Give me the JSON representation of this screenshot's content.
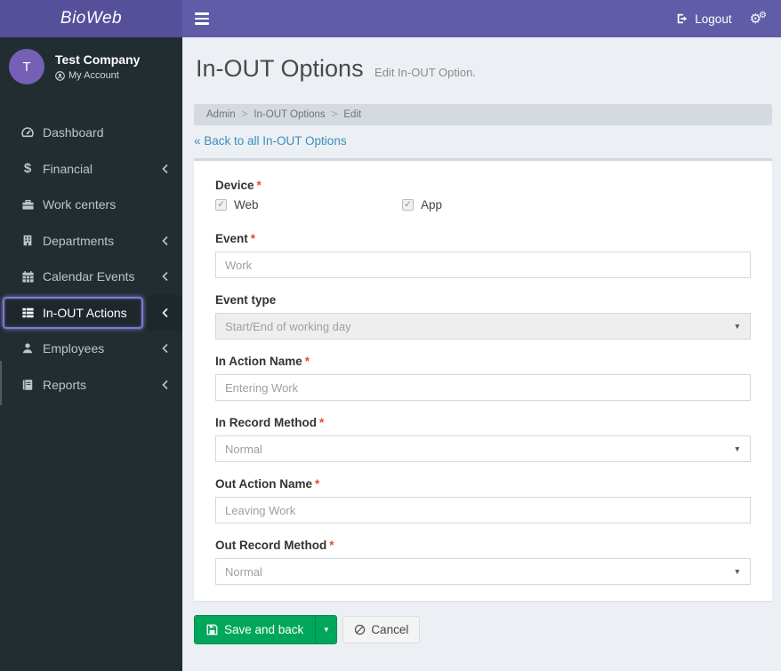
{
  "header": {
    "brand": "BioWeb",
    "logout_label": "Logout"
  },
  "sidebar": {
    "avatar_initial": "T",
    "company_name": "Test Company",
    "account_label": "My Account",
    "items": [
      {
        "label": "Dashboard",
        "has_chevron": false,
        "active": false
      },
      {
        "label": "Financial",
        "has_chevron": true,
        "active": false
      },
      {
        "label": "Work centers",
        "has_chevron": false,
        "active": false
      },
      {
        "label": "Departments",
        "has_chevron": true,
        "active": false
      },
      {
        "label": "Calendar Events",
        "has_chevron": true,
        "active": false
      },
      {
        "label": "In-OUT Actions",
        "has_chevron": true,
        "active": true
      },
      {
        "label": "Employees",
        "has_chevron": true,
        "active": false
      },
      {
        "label": "Reports",
        "has_chevron": true,
        "active": false
      }
    ]
  },
  "page": {
    "title": "In-OUT Options",
    "subtitle": "Edit In-OUT Option.",
    "breadcrumb": {
      "0": "Admin",
      "1": "In-OUT Options",
      "2": "Edit"
    },
    "back_link": "« Back to all In-OUT Options"
  },
  "form": {
    "device": {
      "label": "Device",
      "options": {
        "0": {
          "label": "Web",
          "checked": "✓"
        },
        "1": {
          "label": "App",
          "checked": "✓"
        }
      }
    },
    "fields": {
      "0": {
        "label": "Event",
        "type": "text",
        "value": "Work"
      },
      "1": {
        "label": "Event type",
        "type": "select",
        "value": "Start/End of working day",
        "disabled": true
      },
      "2": {
        "label": "In Action Name",
        "type": "text",
        "value": "Entering Work"
      },
      "3": {
        "label": "In Record Method",
        "type": "select",
        "value": "Normal"
      },
      "4": {
        "label": "Out Action Name",
        "type": "text",
        "value": "Leaving Work"
      },
      "5": {
        "label": "Out Record Method",
        "type": "select",
        "value": "Normal"
      }
    }
  },
  "actions": {
    "save_label": "Save and back",
    "cancel_label": "Cancel"
  },
  "colors": {
    "navbar_purple": "#605ca8",
    "logo_purple": "#56509b",
    "sidebar_dark": "#222d32",
    "avatar_purple": "#7560b5",
    "focus_ring": "#8277cf",
    "content_bg": "#ecf0f5",
    "link_blue": "#3c8dbc",
    "success_green": "#00a65a",
    "required_red": "#dd4b39"
  }
}
